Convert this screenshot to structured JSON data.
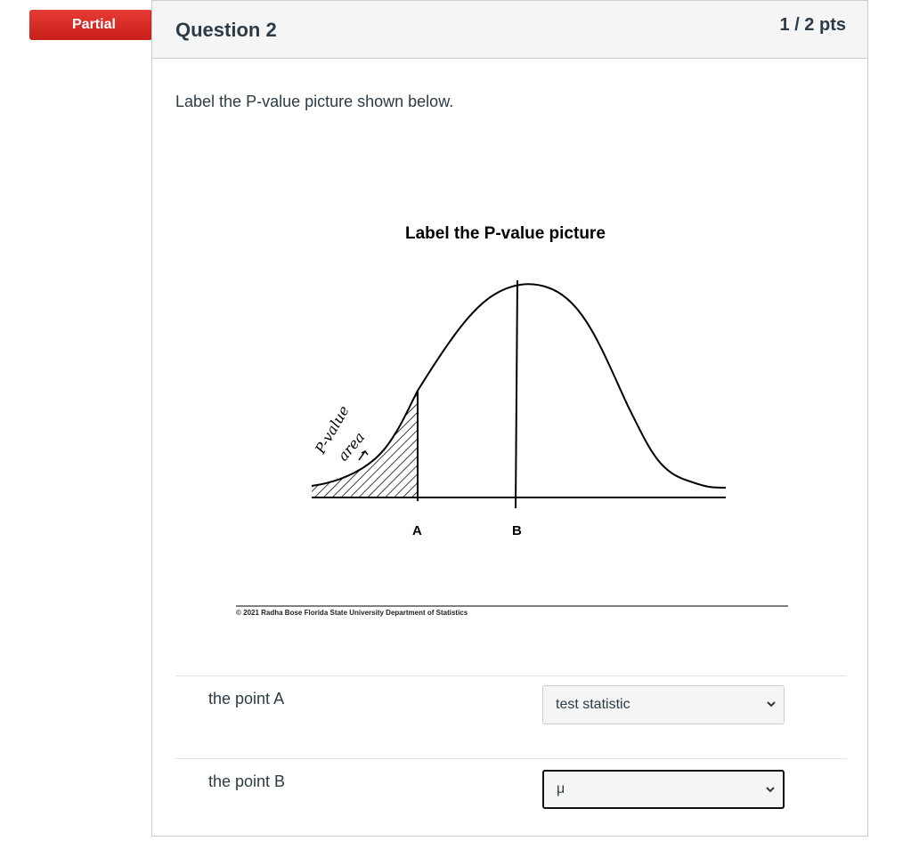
{
  "status": {
    "label": "Partial"
  },
  "question": {
    "title": "Question 2",
    "points": "1 / 2 pts",
    "prompt": "Label the P-value picture shown below."
  },
  "figure": {
    "title": "Label the P-value picture",
    "annotation_line1": "P-value",
    "annotation_line2": "area",
    "point_a": "A",
    "point_b": "B",
    "copyright": "© 2021 Radha Bose Florida State University Department of Statistics"
  },
  "answers": [
    {
      "label": "the point A",
      "selected": "test statistic"
    },
    {
      "label": "the point B",
      "selected": "μ"
    }
  ]
}
